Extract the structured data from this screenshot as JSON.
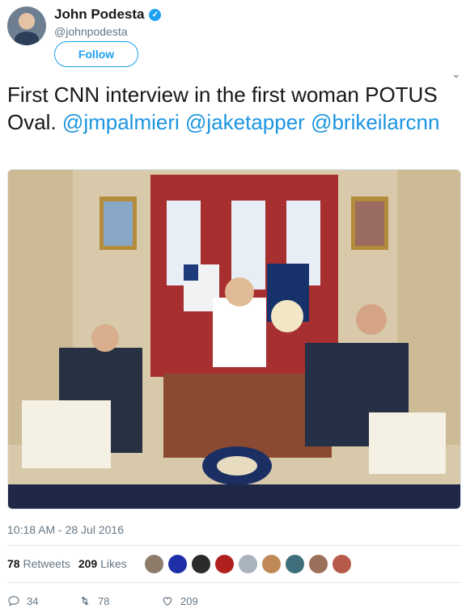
{
  "author": {
    "name": "John Podesta",
    "handle": "@johnpodesta",
    "follow_label": "Follow"
  },
  "tweet": {
    "text_plain": "First CNN interview in the first woman POTUS Oval. ",
    "mentions": [
      "@jmpalmieri",
      "@jaketapper",
      "@brikeilarcnn"
    ],
    "timestamp": "10:18 AM - 28 Jul 2016"
  },
  "stats": {
    "retweets_count": "78",
    "retweets_label": "Retweets",
    "likes_count": "209",
    "likes_label": "Likes"
  },
  "actions": {
    "reply_count": "34",
    "retweet_count": "78",
    "like_count": "209"
  },
  "colors": {
    "accent": "#1da1f2",
    "link": "#1b95e0",
    "muted": "#657786",
    "divider": "#e1e8ed"
  },
  "liker_avatars": [
    "#8f7b6a",
    "#1f2fa8",
    "#2b2b2b",
    "#b0211d",
    "#a9b3bd",
    "#c08a58",
    "#3f6f7a",
    "#9c6f5a",
    "#b65a4a"
  ]
}
